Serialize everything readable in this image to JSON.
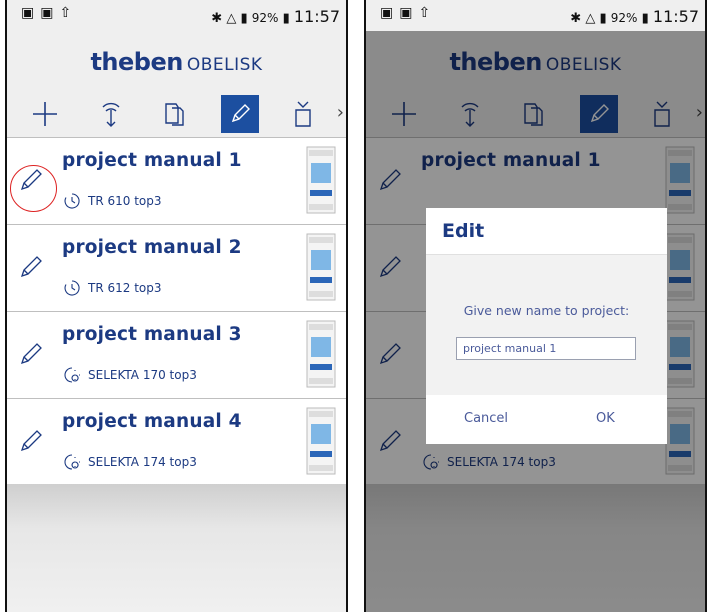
{
  "status_bar": {
    "battery": "92%",
    "time": "11:57"
  },
  "app": {
    "brand": "theben",
    "product": "OBELISK"
  },
  "toolbar": {
    "icons": [
      "add-icon",
      "transfer-icon",
      "copy-icon",
      "edit-icon",
      "delete-icon"
    ],
    "active": "edit-icon",
    "accent": "#1c4fa0"
  },
  "projects": [
    {
      "title": "project manual 1",
      "device": "TR 610 top3",
      "device_icon": "clock-icon"
    },
    {
      "title": "project manual 2",
      "device": "TR 612 top3",
      "device_icon": "clock-icon"
    },
    {
      "title": "project manual 3",
      "device": "SELEKTA 170 top3",
      "device_icon": "astro-clock-icon"
    },
    {
      "title": "project manual 4",
      "device": "SELEKTA 174 top3",
      "device_icon": "astro-clock-icon"
    }
  ],
  "dialog": {
    "title": "Edit",
    "label": "Give new name to project:",
    "value": "project manual 1",
    "cancel": "Cancel",
    "ok": "OK"
  }
}
